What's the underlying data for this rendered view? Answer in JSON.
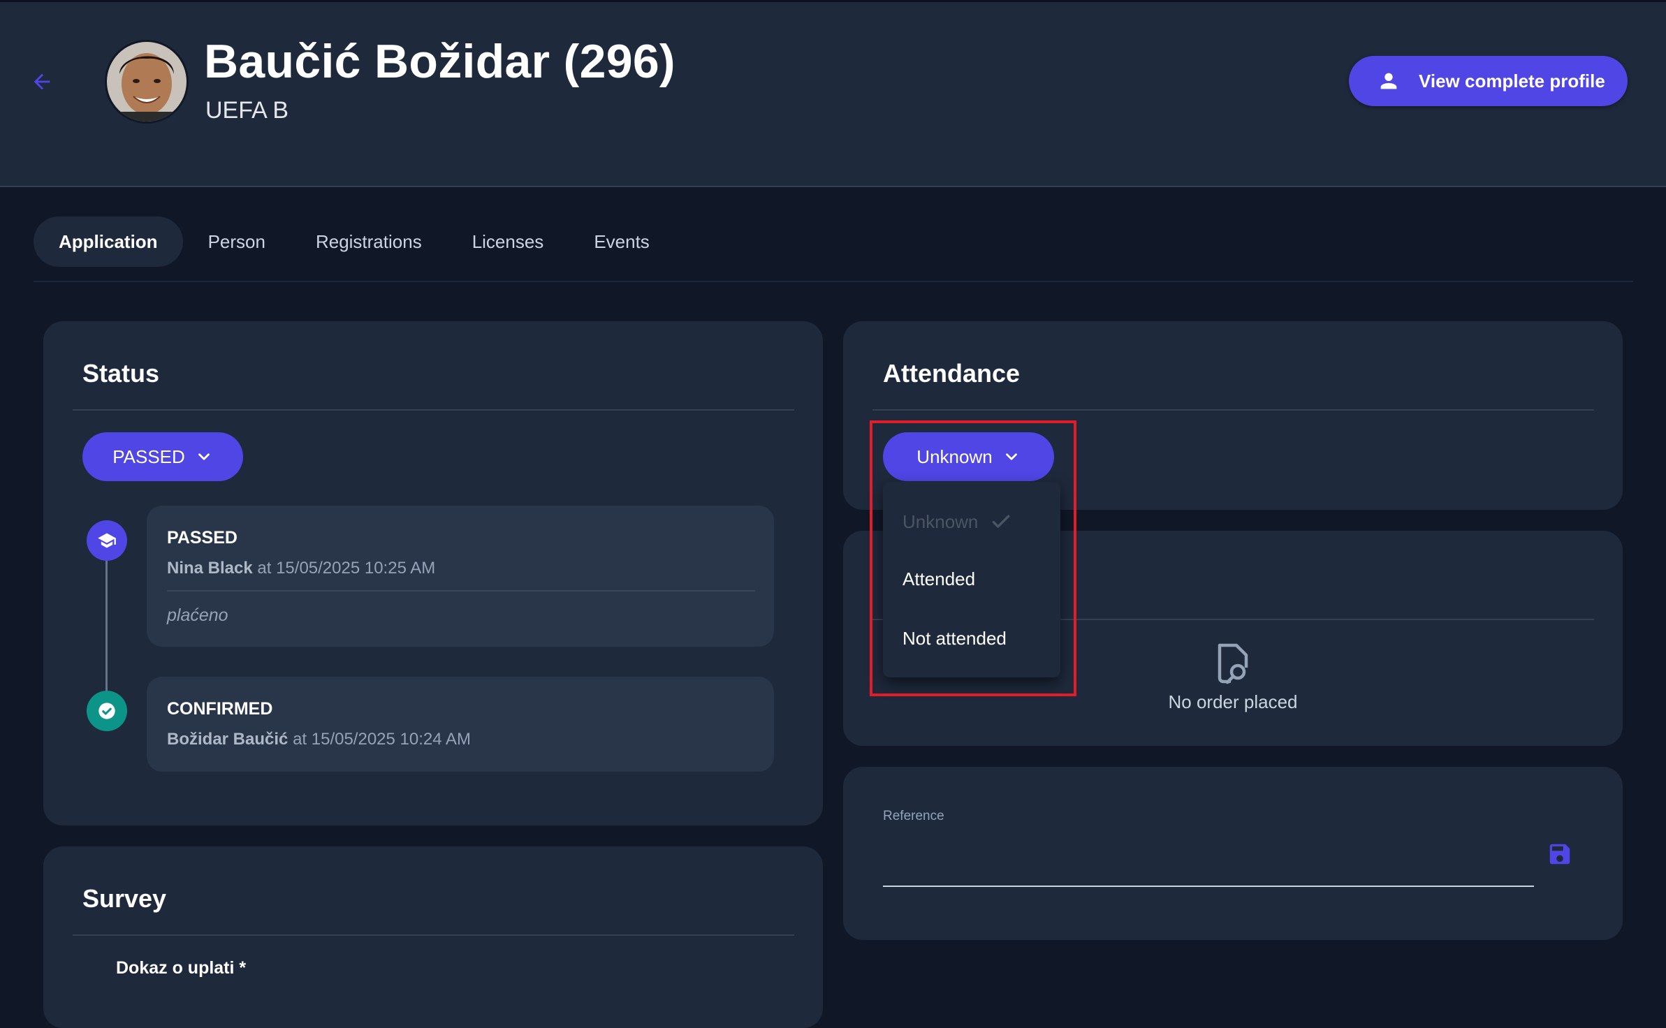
{
  "header": {
    "title": "Baučić Božidar (296)",
    "subtitle": "UEFA B",
    "profile_button": "View complete profile"
  },
  "tabs": [
    {
      "label": "Application",
      "active": true
    },
    {
      "label": "Person",
      "active": false
    },
    {
      "label": "Registrations",
      "active": false
    },
    {
      "label": "Licenses",
      "active": false
    },
    {
      "label": "Events",
      "active": false
    }
  ],
  "status_card": {
    "title": "Status",
    "selected": "PASSED",
    "timeline": [
      {
        "status": "PASSED",
        "user": "Nina Black",
        "at_text": "at 15/05/2025 10:25 AM",
        "note": "plaćeno",
        "icon": "graduation-cap-icon",
        "color": "#4f46e5"
      },
      {
        "status": "CONFIRMED",
        "user": "Božidar Baučić",
        "at_text": "at 15/05/2025 10:24 AM",
        "icon": "check-circle-icon",
        "color": "#0d9488"
      }
    ]
  },
  "survey_card": {
    "title": "Survey",
    "field_label": "Dokaz o uplati *"
  },
  "attendance_card": {
    "title": "Attendance",
    "selected": "Unknown",
    "options": [
      {
        "label": "Unknown",
        "selected": true,
        "disabled": true
      },
      {
        "label": "Attended",
        "selected": false,
        "disabled": false
      },
      {
        "label": "Not attended",
        "selected": false,
        "disabled": false
      }
    ]
  },
  "order_card": {
    "empty_text": "No order placed"
  },
  "reference_card": {
    "label": "Reference",
    "value": ""
  },
  "colors": {
    "accent": "#4f46e5",
    "background": "#101828",
    "card": "#1e293b",
    "success": "#0d9488",
    "highlight": "#e11d2a"
  }
}
